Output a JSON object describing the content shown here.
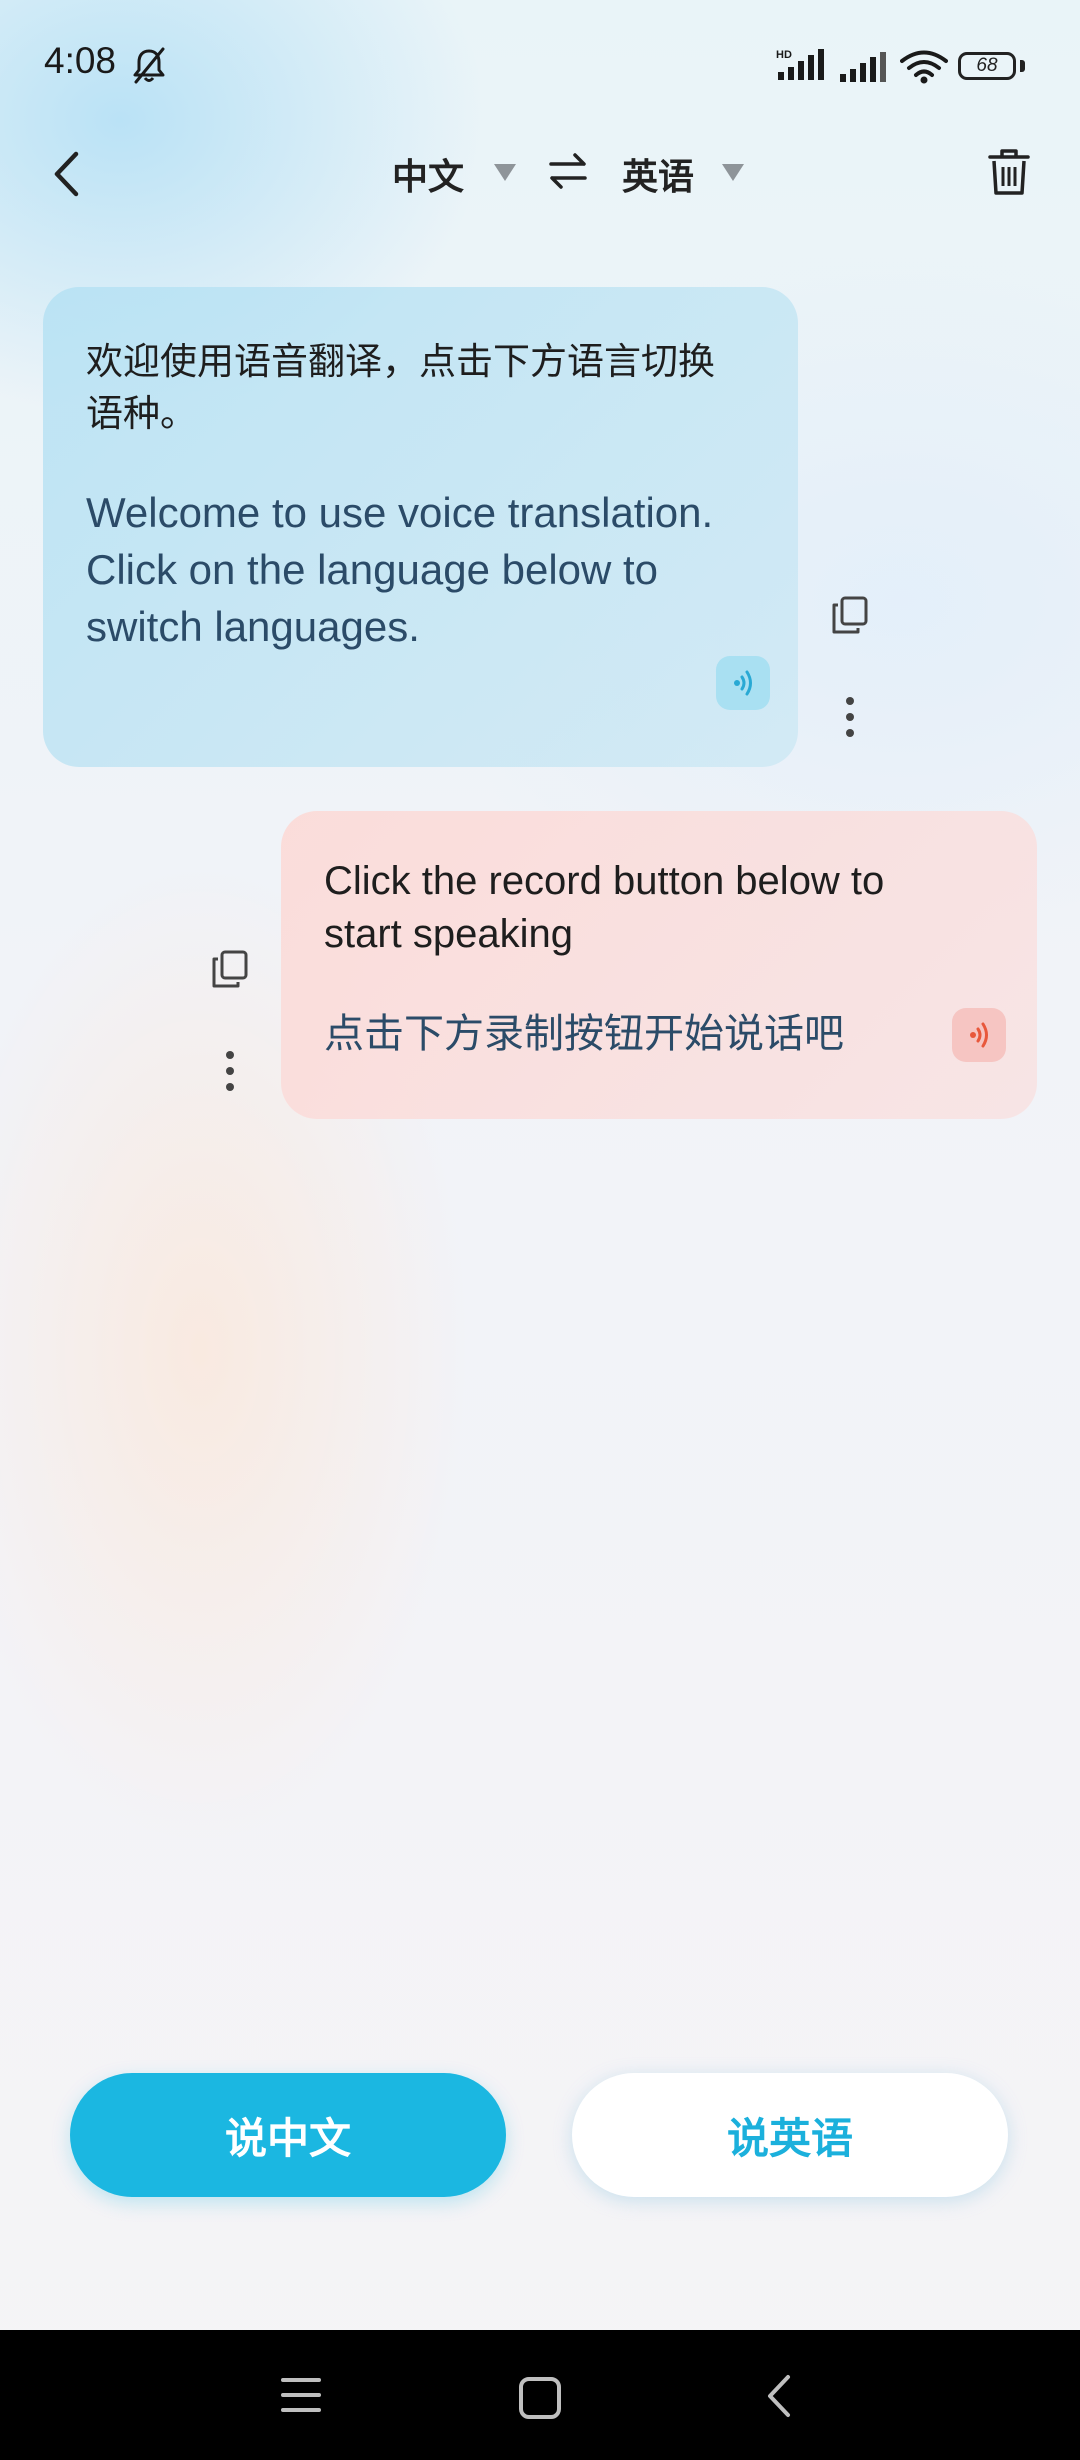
{
  "status_bar": {
    "time": "4:08",
    "battery": "68",
    "network_badge": "HD",
    "icons": [
      "bell-off-icon",
      "signal-icon",
      "signal-icon",
      "wifi-icon",
      "battery-icon"
    ]
  },
  "header": {
    "back_icon": "chevron-left-icon",
    "source_language": "中文",
    "target_language": "英语",
    "swap_icon": "swap-arrows-icon",
    "delete_icon": "trash-icon"
  },
  "messages": [
    {
      "side": "left",
      "original": "欢迎使用语音翻译，点击下方语言切换语种。",
      "translation": "Welcome to use voice translation. Click on the language below to switch languages.",
      "color": "#b5e1f3"
    },
    {
      "side": "right",
      "original": "Click the record button below to start speaking",
      "translation": "点击下方录制按钮开始说话吧",
      "color": "#fcdad7"
    }
  ],
  "actions": {
    "speak_chinese": "说中文",
    "speak_english": "说英语"
  },
  "colors": {
    "accent": "#1bb7e1",
    "left_speaker": "#29a9d4",
    "right_speaker": "#e8583c"
  },
  "nav_bar": {
    "icons": [
      "menu-icon",
      "home-icon",
      "back-icon"
    ]
  }
}
